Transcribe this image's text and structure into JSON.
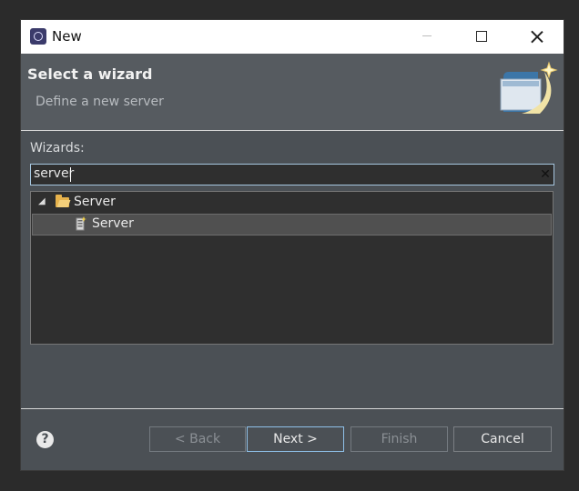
{
  "window": {
    "title": "New"
  },
  "header": {
    "title": "Select a wizard",
    "description": "Define a new server"
  },
  "filter": {
    "label": "Wizards:",
    "value": "server"
  },
  "tree": {
    "items": [
      {
        "label": "Server",
        "expanded": true,
        "icon": "folder-open-icon"
      },
      {
        "label": "Server",
        "selected": true,
        "icon": "server-wizard-icon"
      }
    ]
  },
  "footer": {
    "help": "?",
    "back": "< Back",
    "next": "Next >",
    "finish": "Finish",
    "cancel": "Cancel"
  },
  "colors": {
    "dialog_bg": "#4b5055",
    "header_bg": "#565b60",
    "tree_bg": "#2f2f2f",
    "focus_border": "#8ec0e8"
  }
}
